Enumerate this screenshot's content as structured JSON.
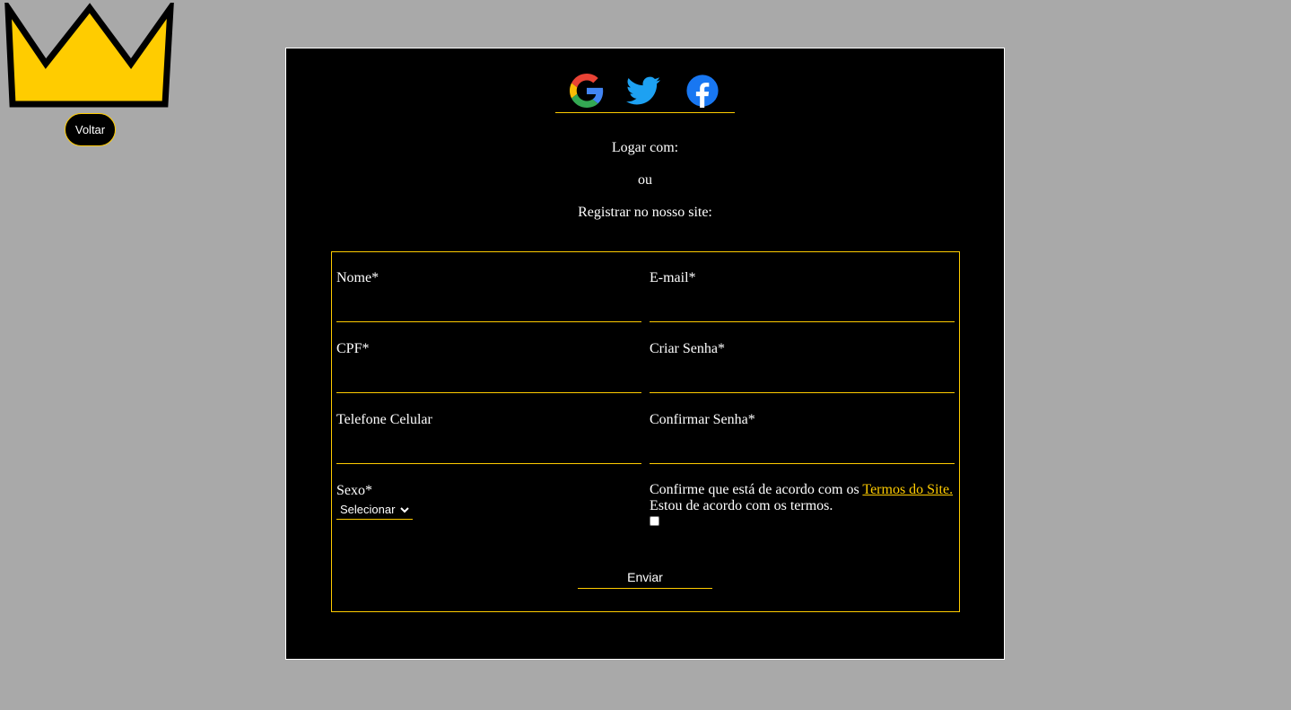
{
  "header": {
    "logo_icon": "crown-icon",
    "back_label": "Voltar"
  },
  "social": {
    "icons": [
      "google-icon",
      "twitter-icon",
      "facebook-icon"
    ]
  },
  "intro": {
    "login_with": "Logar com:",
    "or": "ou",
    "register": "Registrar no nosso site:"
  },
  "form": {
    "fields": {
      "name": {
        "label": "Nome*",
        "value": ""
      },
      "email": {
        "label": "E-mail*",
        "value": ""
      },
      "cpf": {
        "label": "CPF*",
        "value": ""
      },
      "password": {
        "label": "Criar Senha*",
        "value": ""
      },
      "phone": {
        "label": "Telefone Celular",
        "value": ""
      },
      "confirm_password": {
        "label": "Confirmar Senha*",
        "value": ""
      }
    },
    "sex": {
      "label": "Sexo*",
      "selected": "Selecionar"
    },
    "terms": {
      "prefix": "Confirme que está de acordo com os",
      "link": "Termos do Site.",
      "agree": "Estou de acordo com os termos.",
      "checked": false
    },
    "submit_label": "Enviar"
  },
  "colors": {
    "background": "#a9a9a9",
    "panel": "#000000",
    "accent": "#ffcc00",
    "text": "#ffffff"
  }
}
